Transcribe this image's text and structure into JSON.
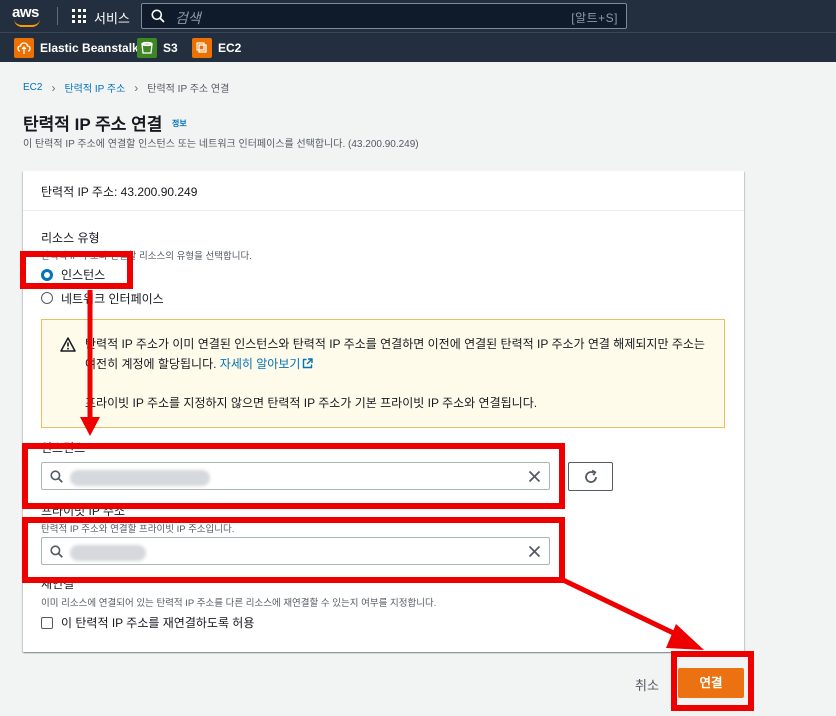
{
  "topnav": {
    "brand": "aws",
    "services_label": "서비스",
    "search_placeholder": "검색",
    "search_shortcut": "[알트+S]"
  },
  "favorites": [
    {
      "label": "Elastic Beanstalk",
      "icon": "elastic-beanstalk-icon"
    },
    {
      "label": "S3",
      "icon": "s3-icon"
    },
    {
      "label": "EC2",
      "icon": "ec2-icon"
    }
  ],
  "breadcrumb": {
    "items": [
      "EC2",
      "탄력적 IP 주소",
      "탄력적 IP 주소 연결"
    ]
  },
  "page": {
    "title": "탄력적 IP 주소 연결",
    "info_label": "정보",
    "description": "이 탄력적 IP 주소에 연결할 인스턴스 또는 네트워크 인터페이스를 선택합니다. (43.200.90.249)"
  },
  "panel": {
    "header": "탄력적 IP 주소: 43.200.90.249",
    "resource_type": {
      "label": "리소스 유형",
      "description": "탄력적 IP 주소와 연결할 리소스의 유형을 선택합니다.",
      "options": [
        {
          "label": "인스턴스",
          "checked": true
        },
        {
          "label": "네트워크 인터페이스",
          "checked": false
        }
      ]
    },
    "alert": {
      "text": "탄력적 IP 주소가 이미 연결된 인스턴스와 탄력적 IP 주소를 연결하면 이전에 연결된 탄력적 IP 주소가 연결 해제되지만 주소는 여전히 계정에 할당됩니다.",
      "link": "자세히 알아보기",
      "text2": "프라이빗 IP 주소를 지정하지 않으면 탄력적 IP 주소가 기본 프라이빗 IP 주소와 연결됩니다."
    },
    "instance": {
      "label": "인스턴스"
    },
    "private_ip": {
      "label": "프라이빗 IP 주소",
      "description": "탄력적 IP 주소와 연결할 프라이빗 IP 주소입니다."
    },
    "reassociation": {
      "label": "재연결",
      "description": "이미 리소스에 연결되어 있는 탄력적 IP 주소를 다른 리소스에 재연결할 수 있는지 여부를 지정합니다.",
      "checkbox_label": "이 탄력적 IP 주소를 재연결하도록 허용",
      "checked": false
    }
  },
  "actions": {
    "cancel": "취소",
    "connect": "연결"
  },
  "colors": {
    "nav_bg": "#232f3e",
    "primary": "#ec7211",
    "link": "#0073bb",
    "annotation_red": "#ee0000"
  }
}
